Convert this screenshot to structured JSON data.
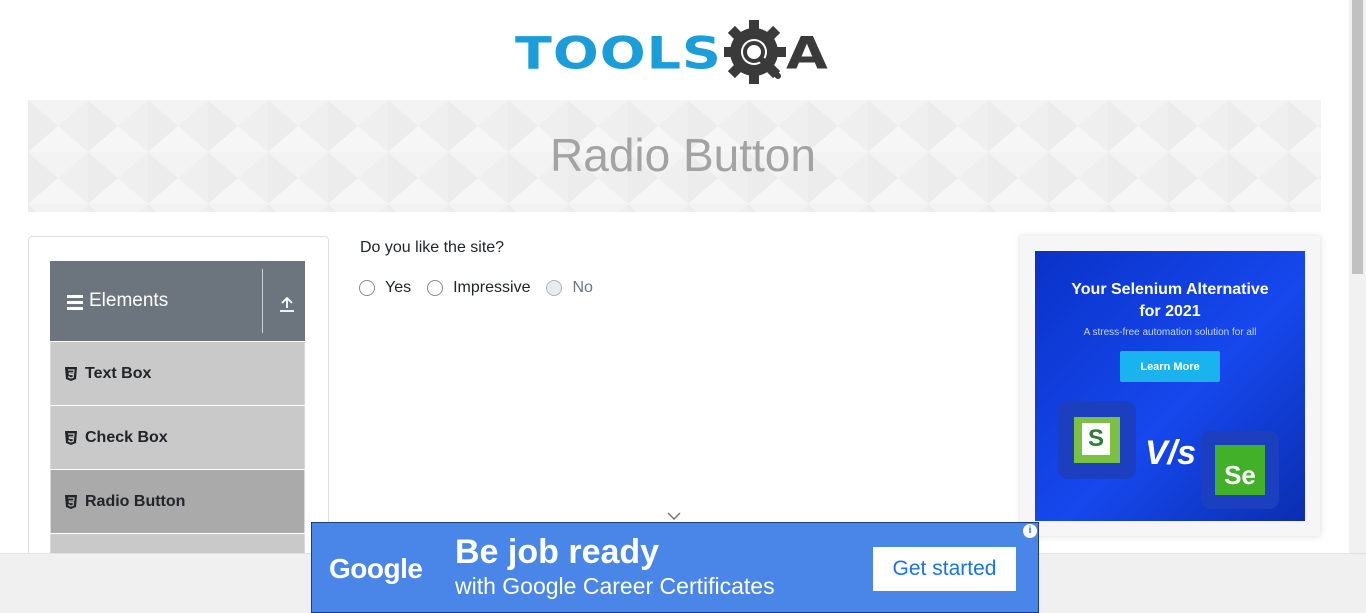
{
  "header": {
    "logo_tools": "TOOLS",
    "logo_a": "A",
    "logo_icon": "gear-magnifier-icon"
  },
  "banner": {
    "title": "Radio Button"
  },
  "sidebar": {
    "group": {
      "title": "Elements",
      "icon": "hamburger-icon",
      "toggle_icon": "collapse-up-icon"
    },
    "items": [
      {
        "label": "Text Box",
        "icon": "html5-icon",
        "active": false
      },
      {
        "label": "Check Box",
        "icon": "html5-icon",
        "active": false
      },
      {
        "label": "Radio Button",
        "icon": "html5-icon",
        "active": true
      }
    ]
  },
  "main": {
    "question": "Do you like the site?",
    "options": [
      {
        "label": "Yes",
        "checked": false,
        "disabled": false
      },
      {
        "label": "Impressive",
        "checked": false,
        "disabled": false
      },
      {
        "label": "No",
        "checked": false,
        "disabled": true
      }
    ]
  },
  "side_ad": {
    "title_line1": "Your Selenium Alternative",
    "title_line2": "for 2021",
    "subtitle": "A stress-free automation solution for all",
    "button": "Learn More",
    "vs": "V/s",
    "logo_left": "S",
    "logo_right": "Se"
  },
  "bottom_ad": {
    "brand": "Google",
    "line1": "Be job ready",
    "line2": "with Google Career Certificates",
    "button": "Get started",
    "info": "i"
  },
  "colors": {
    "brand_blue": "#1a9dd9",
    "sidebar_header": "#6c757d",
    "menu_item_bg": "#c9c9c9",
    "menu_item_active_bg": "#aaaaaa",
    "google_ad_bg": "#4a86e8"
  }
}
